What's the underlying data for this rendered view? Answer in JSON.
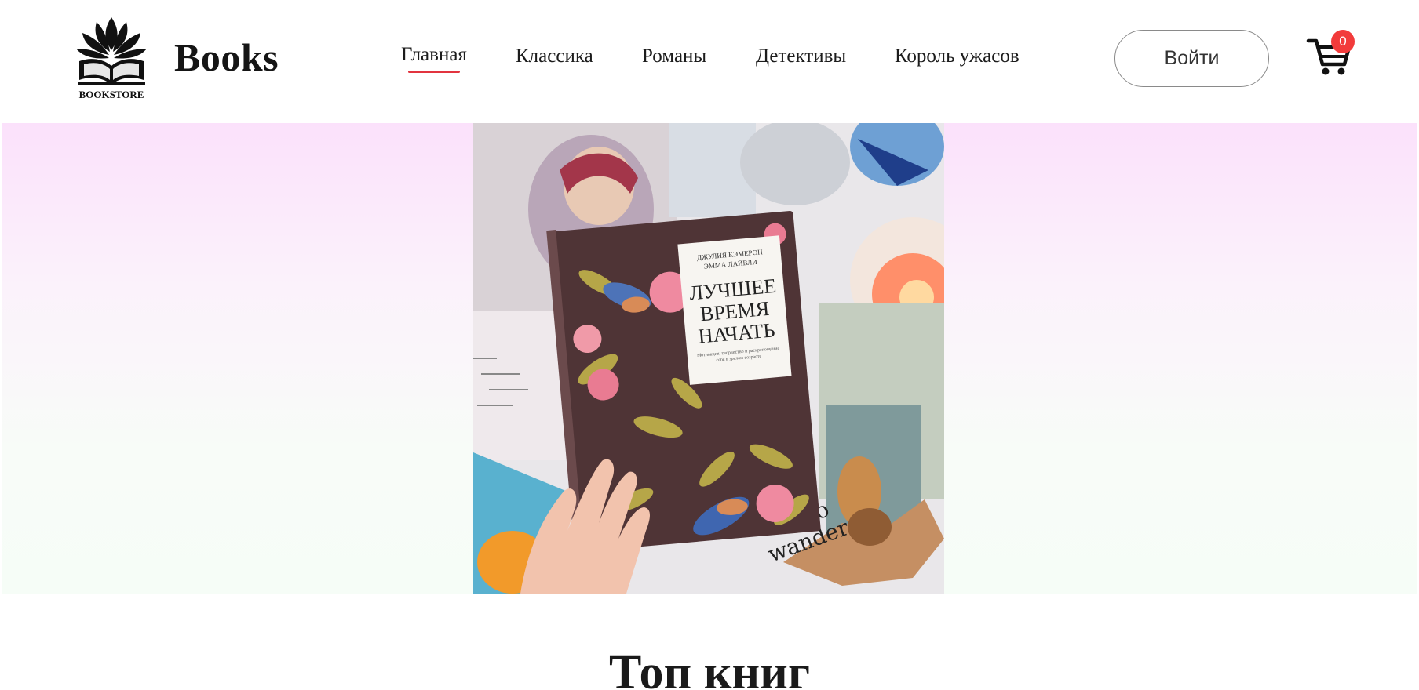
{
  "header": {
    "logo_caption": "BOOKSTORE",
    "brand": "Books",
    "nav": [
      {
        "label": "Главная",
        "active": true
      },
      {
        "label": "Классика",
        "active": false
      },
      {
        "label": "Романы",
        "active": false
      },
      {
        "label": "Детективы",
        "active": false
      },
      {
        "label": "Король ужасов",
        "active": false
      }
    ],
    "login_label": "Войти",
    "cart_icon": "cart-icon",
    "cart_count": "0"
  },
  "hero": {
    "book_authors_line1": "ДЖУЛИЯ КЭМЕРОН",
    "book_authors_line2": "ЭММА ЛАЙВЛИ",
    "book_title_line1": "ЛУЧШЕЕ",
    "book_title_line2": "ВРЕМЯ",
    "book_title_line3": "НАЧАТЬ",
    "book_subtitle": "Мотивация, творчество и раскрепощение себя в зрелом возрасте"
  },
  "main": {
    "section_title": "Топ книг"
  },
  "colors": {
    "accent": "#e2343f",
    "badge": "#f23b3b",
    "hero_top": "#fbe1fb",
    "hero_bottom": "#f6fdf7"
  }
}
